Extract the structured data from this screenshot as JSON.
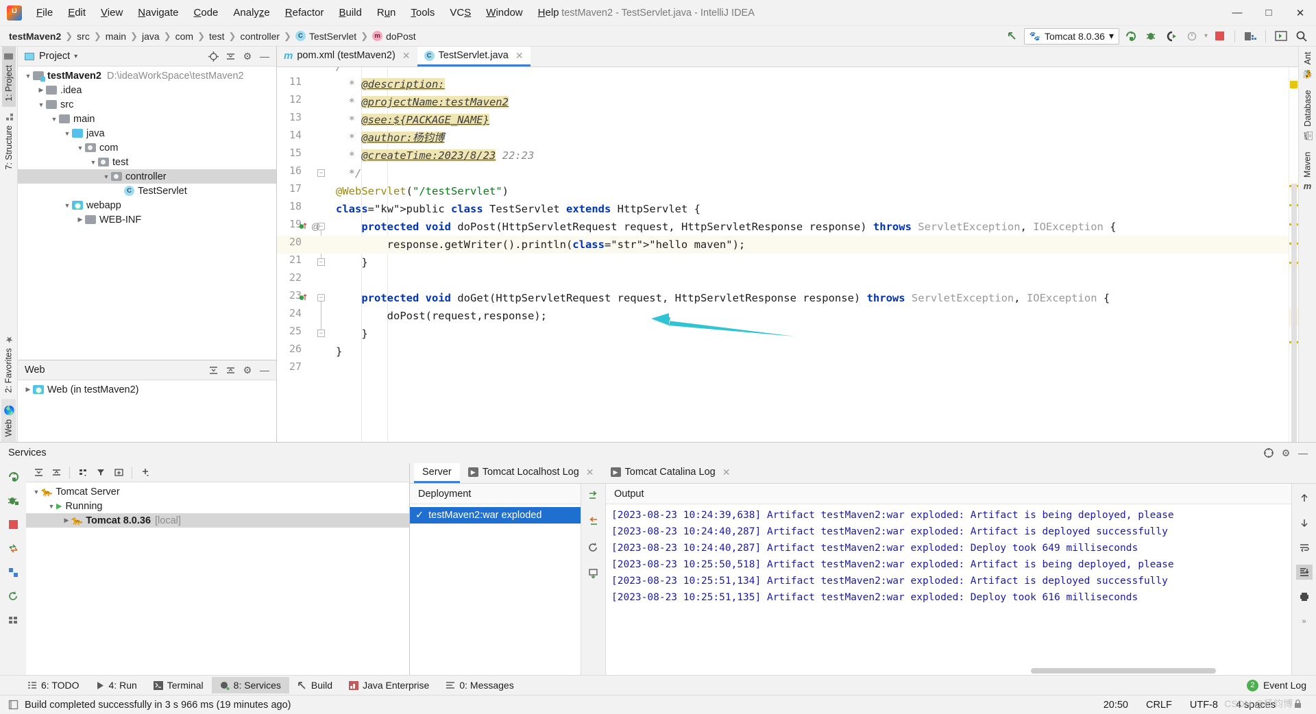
{
  "window": {
    "title": "testMaven2 - TestServlet.java - IntelliJ IDEA",
    "logo": "intellij-idea-logo",
    "minimize": "—",
    "maximize": "□",
    "close": "✕"
  },
  "menu": [
    "File",
    "Edit",
    "View",
    "Navigate",
    "Code",
    "Analyze",
    "Refactor",
    "Build",
    "Run",
    "Tools",
    "VCS",
    "Window",
    "Help"
  ],
  "breadcrumb": [
    {
      "label": "testMaven2",
      "icon": "",
      "bold": true
    },
    {
      "label": "src",
      "icon": ""
    },
    {
      "label": "main",
      "icon": ""
    },
    {
      "label": "java",
      "icon": ""
    },
    {
      "label": "com",
      "icon": ""
    },
    {
      "label": "test",
      "icon": ""
    },
    {
      "label": "controller",
      "icon": ""
    },
    {
      "label": "TestServlet",
      "icon": "C"
    },
    {
      "label": "doPost",
      "icon": "m"
    }
  ],
  "toolbar": {
    "run_config": "Tomcat 8.0.36",
    "cat_icon": "🐱",
    "chevron": "▾",
    "run_icon": "run-icon",
    "debug_icon": "debug-icon",
    "run_coverage_icon": "run-with-coverage-icon",
    "profile_icon": "profile-icon",
    "stop_icon": "stop-icon",
    "updates_icon": "updates-icon",
    "terminal_icon": "terminal-icon",
    "search_icon": "🔍"
  },
  "left_strip": {
    "top": [
      {
        "label": "1: Project",
        "selected": true
      },
      {
        "label": "7: Structure",
        "selected": false
      }
    ],
    "bottom": [
      {
        "label": "2: Favorites",
        "selected": false
      },
      {
        "label": "Web",
        "selected": false
      }
    ]
  },
  "right_strip": {
    "items": [
      {
        "label": "Ant"
      },
      {
        "label": "Database"
      },
      {
        "label": "Maven"
      }
    ]
  },
  "project_panel": {
    "title": "Project",
    "chevron": "▾",
    "actions": [
      "locate-icon",
      "collapse-all-icon",
      "settings-icon",
      "hide-icon"
    ],
    "tree": [
      {
        "indent": 0,
        "arrow": "▼",
        "icon": "module",
        "label": "testMaven2",
        "bold": true,
        "path": "D:\\ideaWorkSpace\\testMaven2",
        "selected": false
      },
      {
        "indent": 1,
        "arrow": "▶",
        "icon": "folder-gray",
        "label": ".idea",
        "bold": false,
        "path": "",
        "selected": false
      },
      {
        "indent": 1,
        "arrow": "▼",
        "icon": "folder-gray",
        "label": "src",
        "bold": false,
        "path": "",
        "selected": false
      },
      {
        "indent": 2,
        "arrow": "▼",
        "icon": "folder-gray",
        "label": "main",
        "bold": false,
        "path": "",
        "selected": false
      },
      {
        "indent": 3,
        "arrow": "▼",
        "icon": "folder-blue",
        "label": "java",
        "bold": false,
        "path": "",
        "selected": false
      },
      {
        "indent": 4,
        "arrow": "▼",
        "icon": "package",
        "label": "com",
        "bold": false,
        "path": "",
        "selected": false
      },
      {
        "indent": 5,
        "arrow": "▼",
        "icon": "package",
        "label": "test",
        "bold": false,
        "path": "",
        "selected": false
      },
      {
        "indent": 6,
        "arrow": "▼",
        "icon": "package",
        "label": "controller",
        "bold": false,
        "path": "",
        "selected": true
      },
      {
        "indent": 7,
        "arrow": "",
        "icon": "class",
        "label": "TestServlet",
        "bold": false,
        "path": "",
        "selected": false
      },
      {
        "indent": 3,
        "arrow": "▼",
        "icon": "folder-web",
        "label": "webapp",
        "bold": false,
        "path": "",
        "selected": false
      },
      {
        "indent": 4,
        "arrow": "▶",
        "icon": "folder-gray",
        "label": "WEB-INF",
        "bold": false,
        "path": "",
        "selected": false
      }
    ]
  },
  "web_panel": {
    "title": "Web",
    "actions": [
      "expand-all-icon",
      "collapse-all-icon",
      "settings-icon",
      "hide-icon"
    ],
    "tree": [
      {
        "indent": 0,
        "arrow": "▶",
        "icon": "folder-web",
        "label": "Web (in testMaven2)"
      }
    ]
  },
  "editor": {
    "tabs": [
      {
        "label": "pom.xml (testMaven2)",
        "icon": "m",
        "active": false,
        "close": "✕"
      },
      {
        "label": "TestServlet.java",
        "icon": "C",
        "active": true,
        "close": "✕"
      }
    ],
    "first_line": 10,
    "lines": [
      {
        "n": 11,
        "text": "  * @description:"
      },
      {
        "n": 12,
        "text": "  * @projectName:testMaven2"
      },
      {
        "n": 13,
        "text": "  * @see:${PACKAGE_NAME}"
      },
      {
        "n": 14,
        "text": "  * @author:杨钧博"
      },
      {
        "n": 15,
        "text": "  * @createTime:2023/8/23 22:23"
      },
      {
        "n": 16,
        "text": "  */"
      },
      {
        "n": 17,
        "text": "@WebServlet(\"/testServlet\")"
      },
      {
        "n": 18,
        "text": "public class TestServlet extends HttpServlet {"
      },
      {
        "n": 19,
        "text": "    protected void doPost(HttpServletRequest request, HttpServletResponse response) throws ServletException, IOException {"
      },
      {
        "n": 20,
        "text": "        response.getWriter().println(\"hello maven\");"
      },
      {
        "n": 21,
        "text": "    }"
      },
      {
        "n": 22,
        "text": ""
      },
      {
        "n": 23,
        "text": "    protected void doGet(HttpServletRequest request, HttpServletResponse response) throws ServletException, IOException {"
      },
      {
        "n": 24,
        "text": "        doPost(request,response);"
      },
      {
        "n": 25,
        "text": "    }"
      },
      {
        "n": 26,
        "text": "}"
      },
      {
        "n": 27,
        "text": ""
      }
    ],
    "caret_line": 20,
    "annotation_arrow_color": "#2ec4d4"
  },
  "services": {
    "title": "Services",
    "header_actions": [
      "help-icon",
      "settings-icon",
      "hide-icon"
    ],
    "left_rail": [
      "rerun-icon",
      "debug-icon",
      "stop-icon",
      "redeploy-icon",
      "deploy-icon",
      "refresh-icon",
      "grid-icon"
    ],
    "toolbar": [
      "expand-all-icon",
      "collapse-all-icon",
      "group-icon",
      "filter-icon",
      "new-tab-icon",
      "add-icon"
    ],
    "tree": [
      {
        "indent": 0,
        "arrow": "▼",
        "icon": "tomcat",
        "label": "Tomcat Server",
        "suffix": "",
        "bold": false,
        "selected": false
      },
      {
        "indent": 1,
        "arrow": "▼",
        "icon": "running",
        "label": "Running",
        "suffix": "",
        "bold": false,
        "selected": false
      },
      {
        "indent": 2,
        "arrow": "▶",
        "icon": "tomcat",
        "label": "Tomcat 8.0.36",
        "suffix": "[local]",
        "bold": true,
        "selected": true
      }
    ],
    "tabs": [
      {
        "label": "Server",
        "icon": "",
        "active": true,
        "close": ""
      },
      {
        "label": "Tomcat Localhost Log",
        "icon": "play",
        "active": false,
        "close": "✕"
      },
      {
        "label": "Tomcat Catalina Log",
        "icon": "play",
        "active": false,
        "close": "✕"
      }
    ],
    "deployment_header": "Deployment",
    "output_header": "Output",
    "deployments": [
      {
        "label": "testMaven2:war exploded",
        "status": "✓",
        "selected": true
      }
    ],
    "deployment_rail": [
      "deploy-artifact-icon",
      "undeploy-artifact-icon",
      "redeploy-icon",
      "update-icon"
    ],
    "output_rail": [
      "up-icon",
      "down-icon",
      "soft-wrap-icon",
      "scroll-to-end-icon",
      "print-icon",
      "expand-more-icon"
    ],
    "output_lines": [
      "[2023-08-23 10:24:39,638] Artifact testMaven2:war exploded: Artifact is being deployed, please",
      "[2023-08-23 10:24:40,287] Artifact testMaven2:war exploded: Artifact is deployed successfully",
      "[2023-08-23 10:24:40,287] Artifact testMaven2:war exploded: Deploy took 649 milliseconds",
      "[2023-08-23 10:25:50,518] Artifact testMaven2:war exploded: Artifact is being deployed, please",
      "[2023-08-23 10:25:51,134] Artifact testMaven2:war exploded: Artifact is deployed successfully",
      "[2023-08-23 10:25:51,135] Artifact testMaven2:war exploded: Deploy took 616 milliseconds"
    ]
  },
  "tool_windows": {
    "items": [
      {
        "label": "6: TODO",
        "icon": "todo-icon",
        "selected": false
      },
      {
        "label": "4: Run",
        "icon": "run-icon",
        "selected": false
      },
      {
        "label": "Terminal",
        "icon": "terminal-icon",
        "selected": false
      },
      {
        "label": "8: Services",
        "icon": "services-icon",
        "selected": true
      },
      {
        "label": "Build",
        "icon": "build-icon",
        "selected": false
      },
      {
        "label": "Java Enterprise",
        "icon": "java-enterprise-icon",
        "selected": false
      },
      {
        "label": "0: Messages",
        "icon": "messages-icon",
        "selected": false
      }
    ],
    "event_log": {
      "label": "Event Log",
      "count": "2"
    }
  },
  "status_bar": {
    "message": "Build completed successfully in 3 s 966 ms (19 minutes ago)",
    "time": "20:50",
    "line_sep": "CRLF",
    "encoding": "UTF-8",
    "indent": "4 spaces",
    "watermark": "CSDN @杨钧博"
  },
  "colors": {
    "accent": "#3c7fd4",
    "selection": "#1f6fd0",
    "annotation_arrow": "#2ec4d4",
    "keyword": "#0033b3",
    "string": "#067d17",
    "comment_highlight": "#efe6b4"
  }
}
